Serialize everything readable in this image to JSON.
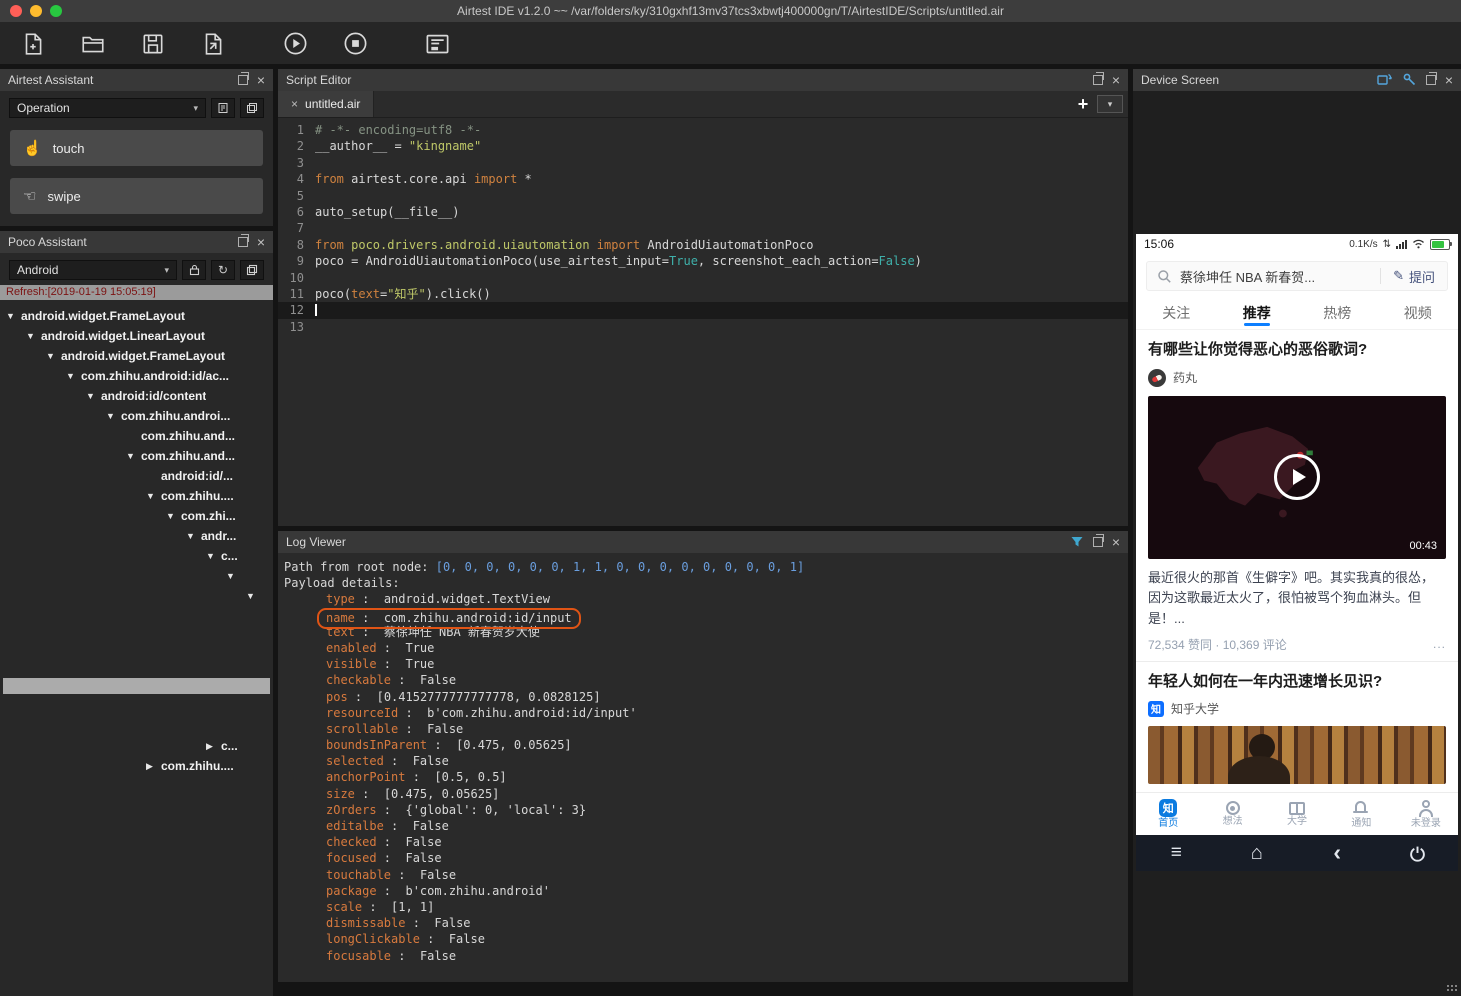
{
  "window": {
    "title": "Airtest IDE v1.2.0 ~~ /var/folders/ky/310gxhf13mv37tcs3xbwtj400000gn/T/AirtestIDE/Scripts/untitled.air"
  },
  "colors": {
    "accent_blue": "#0d7fff",
    "highlight_orange": "#e05415",
    "key_orange": "#d87a3e",
    "string_yellow": "#bfc868",
    "keyword_orange": "#d0823f",
    "bool_teal": "#3fb0aa",
    "battery_green": "#34c340"
  },
  "icons": {
    "close": "×",
    "plus": "+",
    "chevron_down": "▾",
    "tree_expanded": "▼",
    "tree_collapsed": "▶",
    "refresh": "↻",
    "touch_hand": "☝",
    "swipe_hand": "☜",
    "pencil": "✎",
    "menu": "≡",
    "home": "⌂",
    "back": "‹",
    "net_arrows": "⇅",
    "zhihu_logo": "知"
  },
  "airtest_assistant": {
    "title": "Airtest Assistant",
    "mode_selected": "Operation",
    "buttons": [
      {
        "label": "touch"
      },
      {
        "label": "swipe"
      }
    ]
  },
  "poco_assistant": {
    "title": "Poco Assistant",
    "driver_selected": "Android",
    "refresh_text": "Refresh:[2019-01-19 15:05:19]",
    "tree": [
      {
        "level": 0,
        "arrow": "down",
        "label": "android.widget.FrameLayout"
      },
      {
        "level": 1,
        "arrow": "down",
        "label": "android.widget.LinearLayout"
      },
      {
        "level": 2,
        "arrow": "down",
        "label": "android.widget.FrameLayout"
      },
      {
        "level": 3,
        "arrow": "down",
        "label": "com.zhihu.android:id/ac..."
      },
      {
        "level": 4,
        "arrow": "down",
        "label": "android:id/content"
      },
      {
        "level": 5,
        "arrow": "down",
        "label": "com.zhihu.androi..."
      },
      {
        "level": 6,
        "arrow": "none",
        "label": "com.zhihu.and..."
      },
      {
        "level": 6,
        "arrow": "down",
        "label": "com.zhihu.and..."
      },
      {
        "level": 7,
        "arrow": "none",
        "label": "android:id/..."
      },
      {
        "level": 7,
        "arrow": "down",
        "label": "com.zhihu...."
      },
      {
        "level": 8,
        "arrow": "down",
        "label": "com.zhi..."
      },
      {
        "level": 9,
        "arrow": "down",
        "label": "andr..."
      },
      {
        "level": 10,
        "arrow": "down",
        "label": "c..."
      },
      {
        "level": 11,
        "arrow": "down",
        "label": ""
      },
      {
        "level": 12,
        "arrow": "down",
        "label": ""
      }
    ],
    "tree_bottom": [
      {
        "level": 10,
        "arrow": "right",
        "label": "c..."
      },
      {
        "level": 7,
        "arrow": "right",
        "label": "com.zhihu...."
      }
    ]
  },
  "editor": {
    "title": "Script Editor",
    "tab_label": "untitled.air",
    "lines": [
      {
        "n": "1",
        "tokens": [
          [
            "cm",
            "# -*- encoding=utf8 -*-"
          ]
        ]
      },
      {
        "n": "2",
        "tokens": [
          [
            "pl",
            "__author__ = "
          ],
          [
            "str",
            "\"kingname\""
          ]
        ]
      },
      {
        "n": "3",
        "tokens": []
      },
      {
        "n": "4",
        "tokens": [
          [
            "kw",
            "from"
          ],
          [
            "pl",
            " airtest.core.api "
          ],
          [
            "kw",
            "import"
          ],
          [
            "pl",
            " *"
          ]
        ]
      },
      {
        "n": "5",
        "tokens": []
      },
      {
        "n": "6",
        "tokens": [
          [
            "pl",
            "auto_setup(__file__)"
          ]
        ]
      },
      {
        "n": "7",
        "tokens": []
      },
      {
        "n": "8",
        "tokens": [
          [
            "kw",
            "from"
          ],
          [
            "str",
            " poco.drivers.android.uiautomation "
          ],
          [
            "kw",
            "import"
          ],
          [
            "pl",
            " AndroidUiautomationPoco"
          ]
        ]
      },
      {
        "n": "9",
        "tokens": [
          [
            "pl",
            "poco = AndroidUiautomationPoco(use_airtest_input="
          ],
          [
            "bool",
            "True"
          ],
          [
            "pl",
            ", screenshot_each_action="
          ],
          [
            "bool",
            "False"
          ],
          [
            "pl",
            ")"
          ]
        ]
      },
      {
        "n": "10",
        "tokens": []
      },
      {
        "n": "11",
        "tokens": [
          [
            "pl",
            "poco("
          ],
          [
            "kw",
            "text"
          ],
          [
            "pl",
            "="
          ],
          [
            "str",
            "\"知乎\""
          ],
          [
            "pl",
            ").click()"
          ]
        ]
      },
      {
        "n": "12",
        "tokens": [],
        "cursor": true
      },
      {
        "n": "13",
        "tokens": []
      }
    ]
  },
  "log": {
    "title": "Log Viewer",
    "path_label": "Path from root node: ",
    "path_value": "[0, 0, 0, 0, 0, 0, 1, 1, 0, 0, 0, 0, 0, 0, 0, 0, 1]",
    "payload_label": "Payload details:",
    "entries": [
      {
        "key": "type",
        "value": "android.widget.TextView"
      },
      {
        "key": "name",
        "value": "com.zhihu.android:id/input",
        "highlight": true
      },
      {
        "key": "text",
        "value": "蔡徐坤任 NBA 新春贺岁大使"
      },
      {
        "key": "enabled",
        "value": "True"
      },
      {
        "key": "visible",
        "value": "True"
      },
      {
        "key": "checkable",
        "value": "False"
      },
      {
        "key": "pos",
        "value": "[0.4152777777777778, 0.0828125]"
      },
      {
        "key": "resourceId",
        "value": "b'com.zhihu.android:id/input'"
      },
      {
        "key": "scrollable",
        "value": "False"
      },
      {
        "key": "boundsInParent",
        "value": "[0.475, 0.05625]"
      },
      {
        "key": "selected",
        "value": "False"
      },
      {
        "key": "anchorPoint",
        "value": "[0.5, 0.5]"
      },
      {
        "key": "size",
        "value": "[0.475, 0.05625]"
      },
      {
        "key": "zOrders",
        "value": "{'global': 0, 'local': 3}"
      },
      {
        "key": "editalbe",
        "value": "False"
      },
      {
        "key": "checked",
        "value": "False"
      },
      {
        "key": "focused",
        "value": "False"
      },
      {
        "key": "touchable",
        "value": "False"
      },
      {
        "key": "package",
        "value": "b'com.zhihu.android'"
      },
      {
        "key": "scale",
        "value": "[1, 1]"
      },
      {
        "key": "dismissable",
        "value": "False"
      },
      {
        "key": "longClickable",
        "value": "False"
      },
      {
        "key": "focusable",
        "value": "False"
      }
    ]
  },
  "device": {
    "title": "Device Screen",
    "status": {
      "time": "15:06",
      "net": "0.1K/s"
    },
    "search": {
      "query": "蔡徐坤任 NBA 新春贺...",
      "ask": "提问"
    },
    "tabs": [
      {
        "label": "关注",
        "active": false
      },
      {
        "label": "推荐",
        "active": true
      },
      {
        "label": "热榜",
        "active": false
      },
      {
        "label": "视频",
        "active": false
      }
    ],
    "feed": [
      {
        "title": "有哪些让你觉得恶心的恶俗歌词?",
        "author": "药丸",
        "video_duration": "00:43",
        "body": "最近很火的那首《生僻字》吧。其实我真的很怂，因为这歌最近太火了，很怕被骂个狗血淋头。但是！...",
        "stats": "72,534 赞同 · 10,369 评论",
        "more": "..."
      },
      {
        "title": "年轻人如何在一年内迅速增长见识?",
        "author": "知乎大学"
      }
    ],
    "nav": [
      {
        "label": "首页",
        "icon": "home",
        "active": true
      },
      {
        "label": "想法",
        "icon": "idea",
        "active": false
      },
      {
        "label": "大学",
        "icon": "school",
        "active": false
      },
      {
        "label": "通知",
        "icon": "bell",
        "active": false
      },
      {
        "label": "未登录",
        "icon": "user",
        "active": false
      }
    ]
  }
}
